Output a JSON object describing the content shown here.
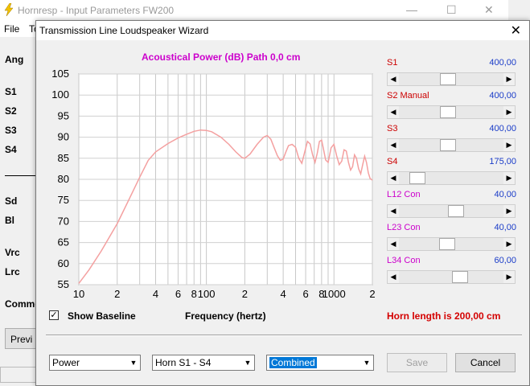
{
  "main_window": {
    "title": "Hornresp - Input Parameters   FW200",
    "menu": [
      "File",
      "To"
    ],
    "side_labels": [
      "Ang",
      "S1",
      "S2",
      "S3",
      "S4",
      "Sd",
      "Bl",
      "Vrc",
      "Lrc",
      "Comme"
    ],
    "prev_button": "Previ",
    "controls": {
      "minimize": "—",
      "maximize": "☐",
      "close": "✕"
    }
  },
  "dialog": {
    "title": "Transmission Line Loudspeaker Wizard",
    "close": "✕",
    "show_baseline_label": "Show Baseline",
    "show_baseline_checked": "✓",
    "horn_length": "Horn length is 200,00 cm",
    "buttons": {
      "save": "Save",
      "cancel": "Cancel"
    },
    "dropdowns": [
      {
        "value": "Power"
      },
      {
        "value": "Horn S1 - S4"
      },
      {
        "value": "Combined"
      }
    ],
    "sliders": [
      {
        "label": "S1",
        "value": "400,00",
        "color": "#cc0000",
        "pos": 0.46
      },
      {
        "label": "S2  Manual",
        "value": "400,00",
        "color": "#cc0000",
        "pos": 0.46
      },
      {
        "label": "S3",
        "value": "400,00",
        "color": "#cc0000",
        "pos": 0.46
      },
      {
        "label": "S4",
        "value": "175,00",
        "color": "#cc0000",
        "pos": 0.12
      },
      {
        "label": "L12  Con",
        "value": "40,00",
        "color": "#cc00cc",
        "pos": 0.55
      },
      {
        "label": "L23  Con",
        "value": "40,00",
        "color": "#cc00cc",
        "pos": 0.45
      },
      {
        "label": "L34  Con",
        "value": "60,00",
        "color": "#cc00cc",
        "pos": 0.6
      }
    ]
  },
  "chart_data": {
    "type": "line",
    "title": "Acoustical Power (dB)   Path 0,0 cm",
    "xlabel": "Frequency (hertz)",
    "ylabel": "",
    "x_scale": "log",
    "xlim": [
      10,
      2000
    ],
    "ylim": [
      55,
      105
    ],
    "yticks": [
      55,
      60,
      65,
      70,
      75,
      80,
      85,
      90,
      95,
      100,
      105
    ],
    "xtick_labels": [
      {
        "x": 10,
        "label": "10"
      },
      {
        "x": 20,
        "label": "2"
      },
      {
        "x": 40,
        "label": "4"
      },
      {
        "x": 60,
        "label": "6"
      },
      {
        "x": 80,
        "label": "8"
      },
      {
        "x": 100,
        "label": "100"
      },
      {
        "x": 200,
        "label": "2"
      },
      {
        "x": 400,
        "label": "4"
      },
      {
        "x": 600,
        "label": "6"
      },
      {
        "x": 800,
        "label": "8"
      },
      {
        "x": 1000,
        "label": "1000"
      },
      {
        "x": 2000,
        "label": "2"
      }
    ],
    "grid": true,
    "line_color": "#f4a0a0",
    "series": [
      {
        "x": [
          10,
          12,
          15,
          20,
          25,
          30,
          35,
          40,
          50,
          60,
          70,
          80,
          90,
          100,
          110,
          130,
          150,
          170,
          190,
          200,
          220,
          250,
          280,
          300,
          320,
          340,
          360,
          380,
          400,
          420,
          440,
          470,
          500,
          530,
          560,
          590,
          620,
          650,
          680,
          710,
          740,
          770,
          800,
          830,
          860,
          900,
          950,
          1000,
          1050,
          1100,
          1150,
          1200,
          1250,
          1300,
          1350,
          1400,
          1450,
          1500,
          1560,
          1620,
          1680,
          1740,
          1800,
          1860,
          1920,
          2000
        ],
        "values": [
          55.3,
          58.5,
          63,
          69.5,
          75.5,
          80.5,
          84.5,
          86.5,
          88.5,
          89.8,
          90.7,
          91.4,
          91.7,
          91.6,
          91.3,
          90,
          88.3,
          86.5,
          85.2,
          85,
          86,
          88.3,
          90,
          90.4,
          89.5,
          87.5,
          85.6,
          84.5,
          84.8,
          86.5,
          88,
          88.3,
          87.6,
          85,
          83.8,
          86.5,
          89,
          88.4,
          85.8,
          84,
          86.2,
          89,
          89.3,
          87,
          84.6,
          84,
          87.5,
          88.3,
          85.6,
          83.5,
          84.3,
          87,
          86.7,
          84,
          82.2,
          83,
          85.8,
          85,
          82.5,
          81.3,
          83.5,
          85.5,
          84,
          81.5,
          80.2,
          79.8
        ]
      }
    ]
  }
}
